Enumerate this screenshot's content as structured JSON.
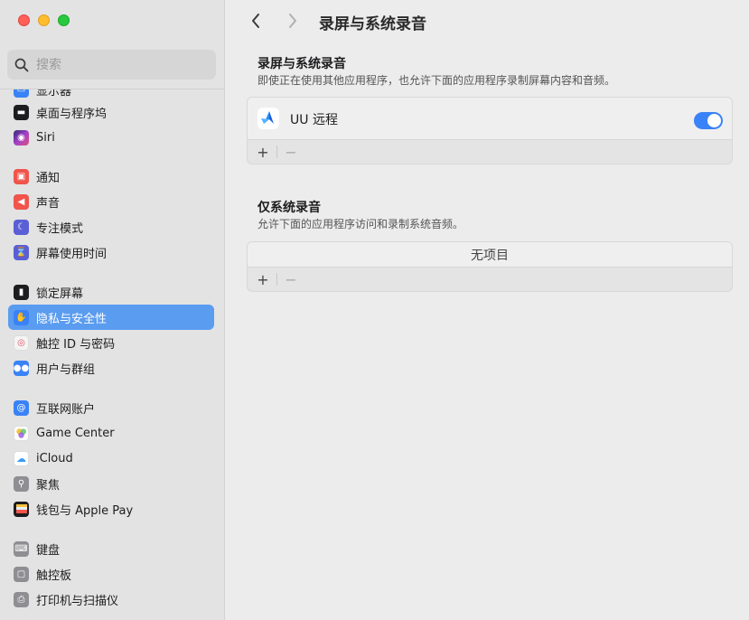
{
  "search": {
    "placeholder": "搜索"
  },
  "sidebar": {
    "items": [
      {
        "label": "显示器",
        "icon": "display-icon",
        "color": "#3a82f7"
      },
      {
        "label": "桌面与程序坞",
        "icon": "dock-icon",
        "color": "#1d1d1f"
      },
      {
        "label": "Siri",
        "icon": "siri-icon",
        "color": "#8a4fd8"
      },
      {
        "label": "通知",
        "icon": "bell-icon",
        "color": "#f0544c"
      },
      {
        "label": "声音",
        "icon": "speaker-icon",
        "color": "#f0544c"
      },
      {
        "label": "专注模式",
        "icon": "moon-icon",
        "color": "#5b5fd6"
      },
      {
        "label": "屏幕使用时间",
        "icon": "hourglass-icon",
        "color": "#5b5fd6"
      },
      {
        "label": "锁定屏幕",
        "icon": "lock-icon",
        "color": "#1d1d1f"
      },
      {
        "label": "隐私与安全性",
        "icon": "hand-icon",
        "color": "#3a82f7"
      },
      {
        "label": "触控 ID 与密码",
        "icon": "fingerprint-icon",
        "color": "#f4f4f4"
      },
      {
        "label": "用户与群组",
        "icon": "users-icon",
        "color": "#3a82f7"
      },
      {
        "label": "互联网账户",
        "icon": "at-icon",
        "color": "#3a82f7"
      },
      {
        "label": "Game Center",
        "icon": "game-center-icon",
        "color": "#ffffff"
      },
      {
        "label": "iCloud",
        "icon": "cloud-icon",
        "color": "#ffffff"
      },
      {
        "label": "聚焦",
        "icon": "spotlight-icon",
        "color": "#8e8e93"
      },
      {
        "label": "钱包与 Apple Pay",
        "icon": "wallet-icon",
        "color": "#1d1d1f"
      },
      {
        "label": "键盘",
        "icon": "keyboard-icon",
        "color": "#8e8e93"
      },
      {
        "label": "触控板",
        "icon": "trackpad-icon",
        "color": "#8e8e93"
      },
      {
        "label": "打印机与扫描仪",
        "icon": "printer-icon",
        "color": "#8e8e93"
      }
    ]
  },
  "header": {
    "title": "录屏与系统录音"
  },
  "screen_audio": {
    "title": "录屏与系统录音",
    "description": "即使正在使用其他应用程序，也允许下面的应用程序录制屏幕内容和音频。",
    "apps": [
      {
        "name": "UU 远程",
        "enabled": true
      }
    ]
  },
  "audio_only": {
    "title": "仅系统录音",
    "description": "允许下面的应用程序访问和录制系统音频。",
    "empty_label": "无项目"
  },
  "controls": {
    "add": "+",
    "remove": "−"
  }
}
